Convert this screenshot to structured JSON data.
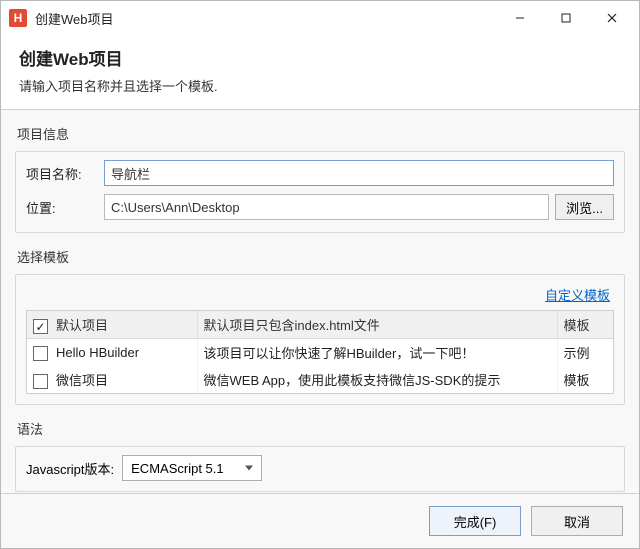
{
  "window": {
    "app_icon_letter": "H",
    "title": "创建Web项目"
  },
  "header": {
    "title": "创建Web项目",
    "subtitle": "请输入项目名称并且选择一个模板."
  },
  "project_info": {
    "section_label": "项目信息",
    "name_label": "项目名称:",
    "name_value": "导航栏",
    "location_label": "位置:",
    "location_value": "C:\\Users\\Ann\\Desktop",
    "browse_button": "浏览..."
  },
  "templates": {
    "section_label": "选择模板",
    "custom_link": "自定义模板",
    "columns": {
      "name": "",
      "desc": "",
      "type": "模板"
    },
    "rows": [
      {
        "checked": true,
        "name": "默认项目",
        "desc": "默认项目只包含index.html文件",
        "type": "模板"
      },
      {
        "checked": false,
        "name": "Hello HBuilder",
        "desc": "该项目可以让你快速了解HBuilder，试一下吧！",
        "type": "示例"
      },
      {
        "checked": false,
        "name": "微信项目",
        "desc": "微信WEB App，使用此模板支持微信JS-SDK的提示",
        "type": "模板"
      }
    ]
  },
  "syntax": {
    "section_label": "语法",
    "js_version_label": "Javascript版本:",
    "js_version_value": "ECMAScript 5.1"
  },
  "footer": {
    "finish": "完成(F)",
    "cancel": "取消"
  }
}
